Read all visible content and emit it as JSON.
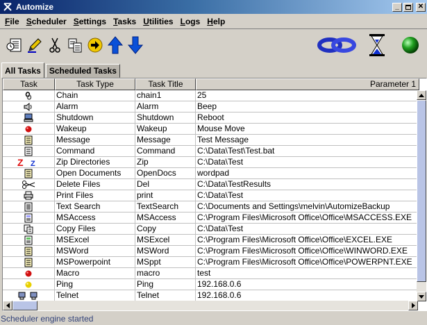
{
  "window": {
    "title": "Automize"
  },
  "menu": [
    {
      "label": "File",
      "u": "F",
      "rest": "ile"
    },
    {
      "label": "Scheduler",
      "u": "S",
      "rest": "cheduler"
    },
    {
      "label": "Settings",
      "u": "S",
      "rest": "ettings"
    },
    {
      "label": "Tasks",
      "u": "T",
      "rest": "asks"
    },
    {
      "label": "Utilities",
      "u": "U",
      "rest": "tilities"
    },
    {
      "label": "Logs",
      "u": "L",
      "rest": "ogs"
    },
    {
      "label": "Help",
      "u": "H",
      "rest": "elp"
    }
  ],
  "toolbar": {
    "icons": [
      "new-task-icon",
      "edit-task-icon",
      "cut-icon",
      "copy-icon",
      "run-icon",
      "move-up-icon",
      "move-down-icon"
    ],
    "right_icons": [
      "chain-link-icon",
      "hourglass-icon",
      "engine-status-icon"
    ]
  },
  "tabs": [
    {
      "label": "All Tasks",
      "active": true
    },
    {
      "label": "Scheduled Tasks",
      "active": false
    }
  ],
  "table": {
    "columns": [
      "Task",
      "Task Type",
      "Task Title",
      "Parameter 1"
    ],
    "rows": [
      {
        "icon": "chain-icon",
        "type": "Chain",
        "title": "chain1",
        "param": "25"
      },
      {
        "icon": "speaker-icon",
        "type": "Alarm",
        "title": "Alarm",
        "param": "Beep"
      },
      {
        "icon": "computer-icon",
        "type": "Shutdown",
        "title": "Shutdown",
        "param": "Reboot"
      },
      {
        "icon": "red-dot-icon",
        "type": "Wakeup",
        "title": "Wakeup",
        "param": "Mouse Move"
      },
      {
        "icon": "message-icon",
        "type": "Message",
        "title": "Message",
        "param": "Test Message"
      },
      {
        "icon": "command-icon",
        "type": "Command",
        "title": "Command",
        "param": "C:\\Data\\Test\\Test.bat"
      },
      {
        "icon": "zip-icon",
        "type": "Zip Directories",
        "title": "Zip",
        "param": "C:\\Data\\Test"
      },
      {
        "icon": "document-icon",
        "type": "Open Documents",
        "title": "OpenDocs",
        "param": "wordpad"
      },
      {
        "icon": "scissors-icon",
        "type": "Delete Files",
        "title": "Del",
        "param": "C:\\Data\\TestResults"
      },
      {
        "icon": "printer-icon",
        "type": "Print Files",
        "title": "print",
        "param": "C:\\Data\\Test"
      },
      {
        "icon": "text-search-icon",
        "type": "Text Search",
        "title": "TextSearch",
        "param": "C:\\Documents and Settings\\melvin\\AutomizeBackup"
      },
      {
        "icon": "msaccess-icon",
        "type": "MSAccess",
        "title": "MSAccess",
        "param": "C:\\Program Files\\Microsoft Office\\Office\\MSACCESS.EXE"
      },
      {
        "icon": "copy-files-icon",
        "type": "Copy Files",
        "title": "Copy",
        "param": "C:\\Data\\Test"
      },
      {
        "icon": "msexcel-icon",
        "type": "MSExcel",
        "title": "MSExcel",
        "param": "C:\\Program Files\\Microsoft Office\\Office\\EXCEL.EXE"
      },
      {
        "icon": "msword-icon",
        "type": "MSWord",
        "title": "MSWord",
        "param": "C:\\Program Files\\Microsoft Office\\Office\\WINWORD.EXE"
      },
      {
        "icon": "mspowerpoint-icon",
        "type": "MSPowerpoint",
        "title": "MSppt",
        "param": "C:\\Program Files\\Microsoft Office\\Office\\POWERPNT.EXE"
      },
      {
        "icon": "red-dot-icon",
        "type": "Macro",
        "title": "macro",
        "param": "test"
      },
      {
        "icon": "yellow-dot-icon",
        "type": "Ping",
        "title": "Ping",
        "param": "192.168.0.6"
      },
      {
        "icon": "telnet-icon",
        "type": "Telnet",
        "title": "Telnet",
        "param": "192.168.0.6"
      }
    ]
  },
  "status": {
    "text": "Scheduler engine started"
  },
  "colors": {
    "title_start": "#0a246a",
    "title_end": "#a6caf0",
    "status_text": "#33437a"
  }
}
